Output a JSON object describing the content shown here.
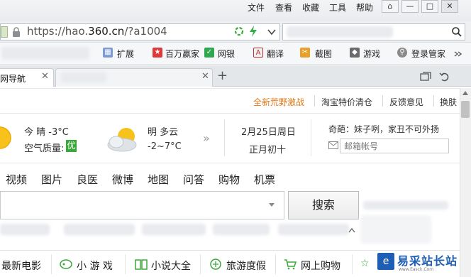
{
  "menubar": {
    "items": [
      "文件",
      "查看",
      "收藏",
      "工具",
      "帮助"
    ],
    "window_buttons": [
      "⌂",
      "—",
      "□",
      "✕"
    ]
  },
  "address": {
    "scheme": "https://hao.",
    "host": "360.cn",
    "path": "/?a1004"
  },
  "toolbar": {
    "items": [
      "扩展",
      "百万赢家",
      "网银",
      "翻译",
      "截图",
      "游戏",
      "登录管家"
    ]
  },
  "tabs": {
    "active_label": "网导航"
  },
  "infobar": {
    "links": [
      "全新荒野激战",
      "淘宝特价清仓",
      "反馈意见",
      "换肤"
    ]
  },
  "weather": {
    "today": "今  晴  -3°C",
    "aq_label": "空气质量:",
    "aq_value": "优",
    "tomorrow_cond": "明 多云",
    "tomorrow_temp": "-2~7°C",
    "date": "2月25日周日",
    "lunar": "正月初十",
    "quote": "奇葩：妹子咧，家丑不可外扬",
    "mail_placeholder": "邮箱帐号"
  },
  "nav": {
    "items": [
      "视频",
      "图片",
      "良医",
      "微博",
      "地图",
      "问答",
      "购物",
      "机票"
    ]
  },
  "search": {
    "button": "搜索"
  },
  "bottom": {
    "items": [
      "最新电影",
      "小 游 戏",
      "小说大全",
      "旅游度假",
      "网上购物"
    ]
  },
  "colors": {
    "accent_orange": "#e07a18",
    "brand_green": "#3aa839",
    "link_blue": "#2a6fd6"
  }
}
